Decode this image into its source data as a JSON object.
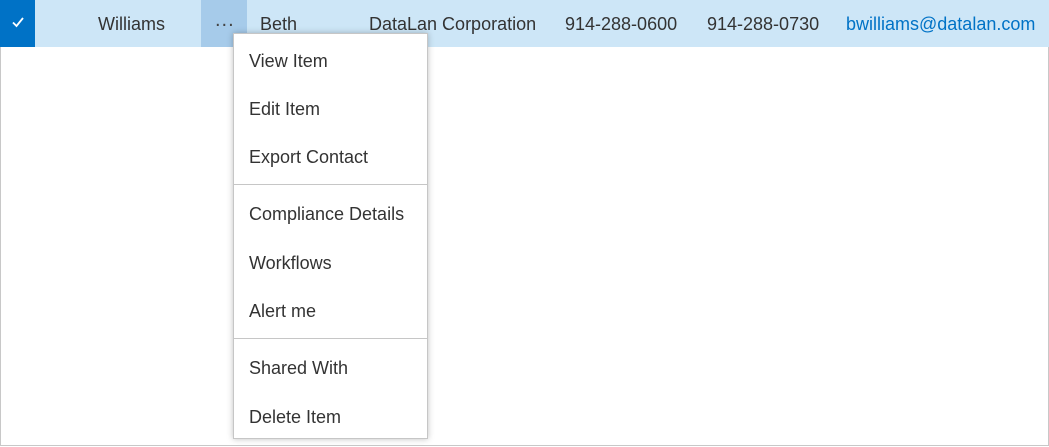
{
  "row": {
    "last_name": "Williams",
    "first_name": "Beth",
    "company": "DataLan Corporation",
    "phone1": "914-288-0600",
    "phone2": "914-288-0730",
    "email": "bwilliams@datalan.com",
    "ellipsis": "..."
  },
  "menu": {
    "items": [
      "View Item",
      "Edit Item",
      "Export Contact",
      "Compliance Details",
      "Workflows",
      "Alert me",
      "Shared With",
      "Delete Item"
    ]
  },
  "colors": {
    "selected_row": "#cde6f7",
    "check_accent": "#0072c6",
    "ellipsis_bg": "#a6cbea",
    "link": "#0072c6"
  }
}
